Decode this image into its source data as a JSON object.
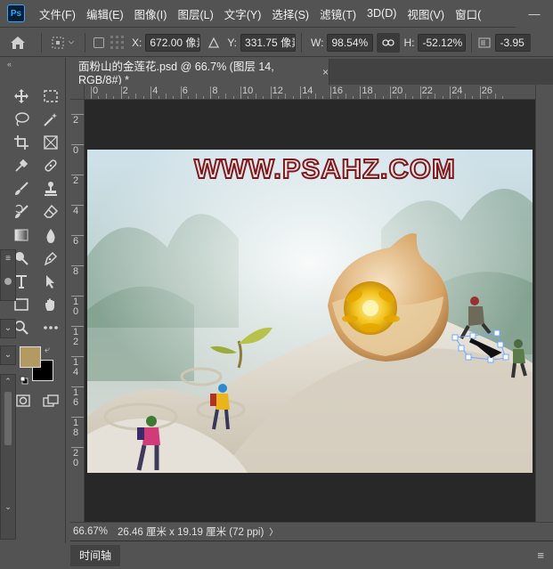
{
  "app": {
    "logo": "Ps"
  },
  "menu": [
    "文件(F)",
    "编辑(E)",
    "图像(I)",
    "图层(L)",
    "文字(Y)",
    "选择(S)",
    "滤镜(T)",
    "3D(D)",
    "视图(V)",
    "窗口("
  ],
  "window_controls": {
    "minimize": "—",
    "maximize": "☐",
    "close": "✕"
  },
  "options": {
    "x_label": "X:",
    "x_value": "672.00 像素",
    "y_label": "Y:",
    "y_value": "331.75 像素",
    "w_label": "W:",
    "w_value": "98.54%",
    "h_label": "H:",
    "h_value": "-52.12%",
    "angle_value": "-3.95"
  },
  "document": {
    "tab_title": "面粉山的金莲花.psd @ 66.7% (图层 14, RGB/8#) *",
    "close_glyph": "×",
    "watermark": "WWW.PSAHZ.COM"
  },
  "ruler": {
    "h_labels": [
      "0",
      "2",
      "4",
      "6",
      "8",
      "10",
      "12",
      "14",
      "16",
      "18",
      "20",
      "22",
      "24",
      "26"
    ],
    "v_labels": [
      "2",
      "0",
      "2",
      "4",
      "6",
      "8",
      "1\n0",
      "1\n2",
      "1\n4",
      "1\n6",
      "1\n8",
      "2\n0"
    ]
  },
  "status": {
    "zoom": "66.67%",
    "doc_size": "26.46 厘米 x 19.19 厘米 (72 ppi)",
    "arrow": "〉"
  },
  "timeline": {
    "label": "时间轴"
  },
  "colors": {
    "foreground": "#b39a63",
    "background": "#000000",
    "ui_bg": "#535353",
    "canvas_bg": "#282828",
    "accent": "#31a8ff"
  },
  "icons": [
    "move-icon",
    "marquee-icon",
    "lasso-icon",
    "magic-wand-icon",
    "crop-icon",
    "frame-icon",
    "eyedropper-icon",
    "healing-icon",
    "brush-icon",
    "stamp-icon",
    "history-brush-icon",
    "eraser-icon",
    "gradient-icon",
    "blur-icon",
    "dodge-icon",
    "pen-icon",
    "type-icon",
    "path-select-icon",
    "rectangle-icon",
    "hand-icon",
    "zoom-icon",
    "more-icon"
  ]
}
